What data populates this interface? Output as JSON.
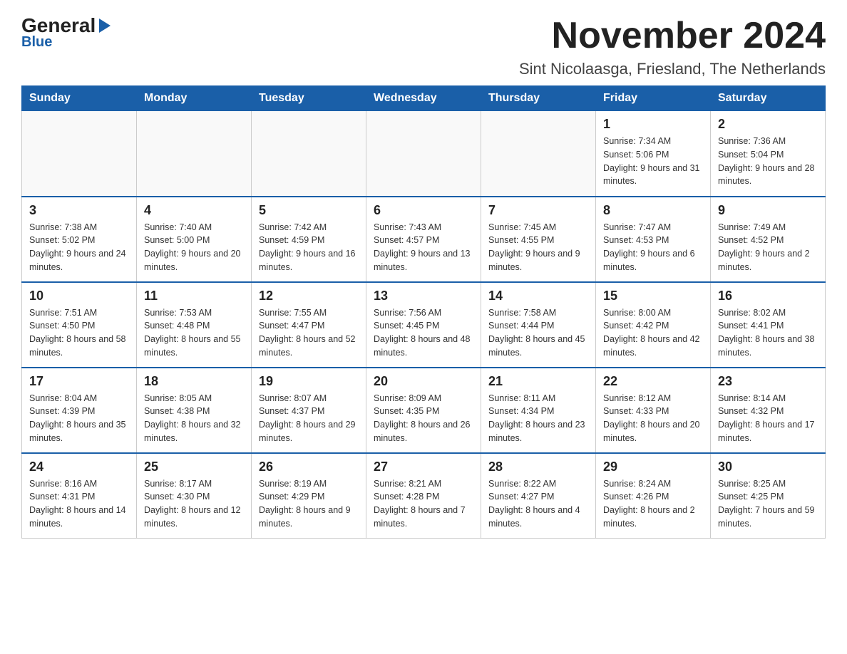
{
  "logo": {
    "general": "General",
    "blue": "Blue",
    "arrow": "▶"
  },
  "title": "November 2024",
  "subtitle": "Sint Nicolaasga, Friesland, The Netherlands",
  "days_of_week": [
    "Sunday",
    "Monday",
    "Tuesday",
    "Wednesday",
    "Thursday",
    "Friday",
    "Saturday"
  ],
  "weeks": [
    [
      {
        "day": "",
        "info": ""
      },
      {
        "day": "",
        "info": ""
      },
      {
        "day": "",
        "info": ""
      },
      {
        "day": "",
        "info": ""
      },
      {
        "day": "",
        "info": ""
      },
      {
        "day": "1",
        "info": "Sunrise: 7:34 AM\nSunset: 5:06 PM\nDaylight: 9 hours and 31 minutes."
      },
      {
        "day": "2",
        "info": "Sunrise: 7:36 AM\nSunset: 5:04 PM\nDaylight: 9 hours and 28 minutes."
      }
    ],
    [
      {
        "day": "3",
        "info": "Sunrise: 7:38 AM\nSunset: 5:02 PM\nDaylight: 9 hours and 24 minutes."
      },
      {
        "day": "4",
        "info": "Sunrise: 7:40 AM\nSunset: 5:00 PM\nDaylight: 9 hours and 20 minutes."
      },
      {
        "day": "5",
        "info": "Sunrise: 7:42 AM\nSunset: 4:59 PM\nDaylight: 9 hours and 16 minutes."
      },
      {
        "day": "6",
        "info": "Sunrise: 7:43 AM\nSunset: 4:57 PM\nDaylight: 9 hours and 13 minutes."
      },
      {
        "day": "7",
        "info": "Sunrise: 7:45 AM\nSunset: 4:55 PM\nDaylight: 9 hours and 9 minutes."
      },
      {
        "day": "8",
        "info": "Sunrise: 7:47 AM\nSunset: 4:53 PM\nDaylight: 9 hours and 6 minutes."
      },
      {
        "day": "9",
        "info": "Sunrise: 7:49 AM\nSunset: 4:52 PM\nDaylight: 9 hours and 2 minutes."
      }
    ],
    [
      {
        "day": "10",
        "info": "Sunrise: 7:51 AM\nSunset: 4:50 PM\nDaylight: 8 hours and 58 minutes."
      },
      {
        "day": "11",
        "info": "Sunrise: 7:53 AM\nSunset: 4:48 PM\nDaylight: 8 hours and 55 minutes."
      },
      {
        "day": "12",
        "info": "Sunrise: 7:55 AM\nSunset: 4:47 PM\nDaylight: 8 hours and 52 minutes."
      },
      {
        "day": "13",
        "info": "Sunrise: 7:56 AM\nSunset: 4:45 PM\nDaylight: 8 hours and 48 minutes."
      },
      {
        "day": "14",
        "info": "Sunrise: 7:58 AM\nSunset: 4:44 PM\nDaylight: 8 hours and 45 minutes."
      },
      {
        "day": "15",
        "info": "Sunrise: 8:00 AM\nSunset: 4:42 PM\nDaylight: 8 hours and 42 minutes."
      },
      {
        "day": "16",
        "info": "Sunrise: 8:02 AM\nSunset: 4:41 PM\nDaylight: 8 hours and 38 minutes."
      }
    ],
    [
      {
        "day": "17",
        "info": "Sunrise: 8:04 AM\nSunset: 4:39 PM\nDaylight: 8 hours and 35 minutes."
      },
      {
        "day": "18",
        "info": "Sunrise: 8:05 AM\nSunset: 4:38 PM\nDaylight: 8 hours and 32 minutes."
      },
      {
        "day": "19",
        "info": "Sunrise: 8:07 AM\nSunset: 4:37 PM\nDaylight: 8 hours and 29 minutes."
      },
      {
        "day": "20",
        "info": "Sunrise: 8:09 AM\nSunset: 4:35 PM\nDaylight: 8 hours and 26 minutes."
      },
      {
        "day": "21",
        "info": "Sunrise: 8:11 AM\nSunset: 4:34 PM\nDaylight: 8 hours and 23 minutes."
      },
      {
        "day": "22",
        "info": "Sunrise: 8:12 AM\nSunset: 4:33 PM\nDaylight: 8 hours and 20 minutes."
      },
      {
        "day": "23",
        "info": "Sunrise: 8:14 AM\nSunset: 4:32 PM\nDaylight: 8 hours and 17 minutes."
      }
    ],
    [
      {
        "day": "24",
        "info": "Sunrise: 8:16 AM\nSunset: 4:31 PM\nDaylight: 8 hours and 14 minutes."
      },
      {
        "day": "25",
        "info": "Sunrise: 8:17 AM\nSunset: 4:30 PM\nDaylight: 8 hours and 12 minutes."
      },
      {
        "day": "26",
        "info": "Sunrise: 8:19 AM\nSunset: 4:29 PM\nDaylight: 8 hours and 9 minutes."
      },
      {
        "day": "27",
        "info": "Sunrise: 8:21 AM\nSunset: 4:28 PM\nDaylight: 8 hours and 7 minutes."
      },
      {
        "day": "28",
        "info": "Sunrise: 8:22 AM\nSunset: 4:27 PM\nDaylight: 8 hours and 4 minutes."
      },
      {
        "day": "29",
        "info": "Sunrise: 8:24 AM\nSunset: 4:26 PM\nDaylight: 8 hours and 2 minutes."
      },
      {
        "day": "30",
        "info": "Sunrise: 8:25 AM\nSunset: 4:25 PM\nDaylight: 7 hours and 59 minutes."
      }
    ]
  ]
}
